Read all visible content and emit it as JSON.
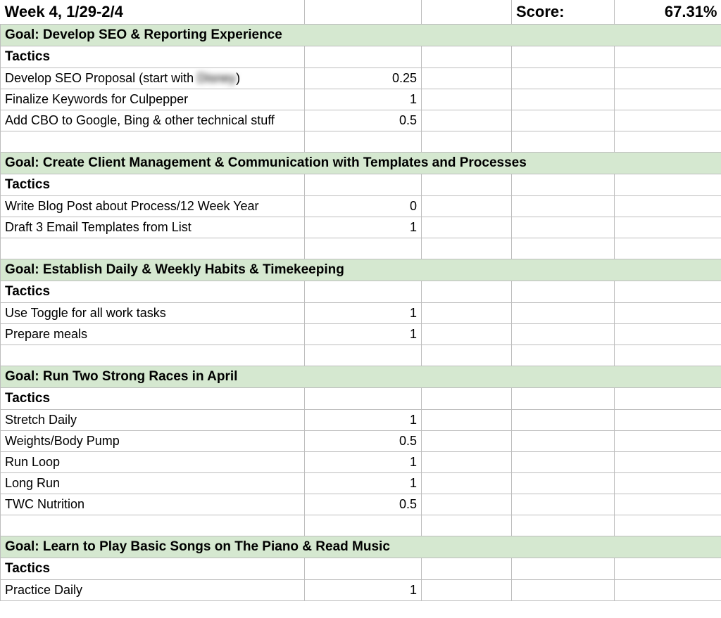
{
  "header": {
    "week_title": "Week 4, 1/29-2/4",
    "score_label": "Score:",
    "score_value": "67.31%"
  },
  "tactics_label": "Tactics",
  "goals": [
    {
      "title": "Goal: Develop SEO & Reporting Experience",
      "tactics": [
        {
          "label_prefix": "Develop SEO Proposal (start with",
          "label_blur": "Disney",
          "label_suffix": ")",
          "value": "0.25"
        },
        {
          "label": "Finalize Keywords for Culpepper",
          "value": "1"
        },
        {
          "label": "Add CBO to Google, Bing & other technical stuff",
          "value": "0.5"
        }
      ]
    },
    {
      "title": "Goal: Create Client Management & Communication with Templates and Processes",
      "tactics": [
        {
          "label": "Write Blog Post about Process/12 Week Year",
          "value": "0"
        },
        {
          "label": "Draft 3 Email Templates from List",
          "value": "1"
        }
      ]
    },
    {
      "title": "Goal: Establish Daily & Weekly Habits & Timekeeping",
      "tactics": [
        {
          "label": "Use Toggle for all work tasks",
          "value": "1"
        },
        {
          "label": "Prepare meals",
          "value": "1"
        }
      ]
    },
    {
      "title": "Goal: Run Two Strong Races in April",
      "tactics": [
        {
          "label": "Stretch Daily",
          "value": "1"
        },
        {
          "label": "Weights/Body Pump",
          "value": "0.5"
        },
        {
          "label": "Run Loop",
          "value": "1"
        },
        {
          "label": "Long Run",
          "value": "1"
        },
        {
          "label": "TWC Nutrition",
          "value": "0.5"
        }
      ]
    },
    {
      "title": "Goal: Learn to Play Basic Songs on The Piano & Read Music",
      "tactics": [
        {
          "label": "Practice Daily",
          "value": "1"
        }
      ]
    }
  ]
}
